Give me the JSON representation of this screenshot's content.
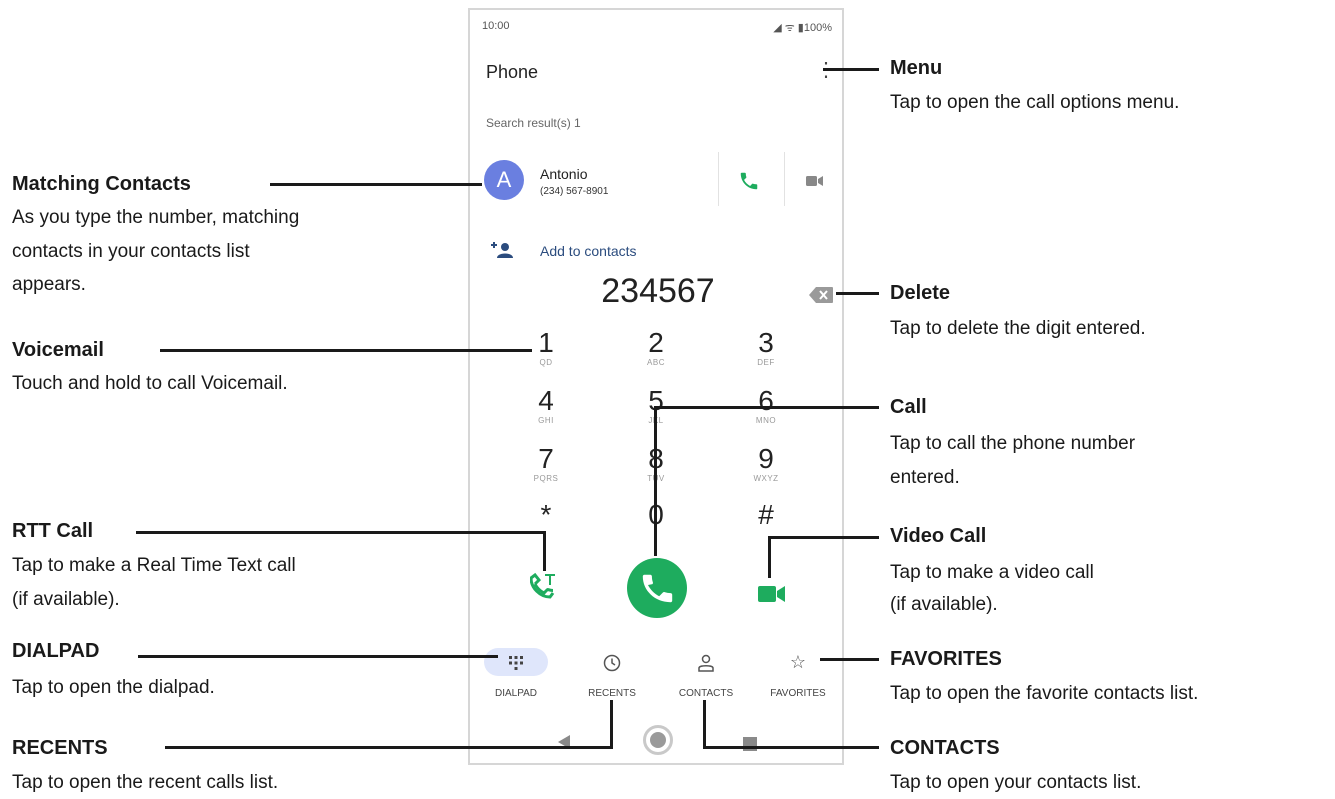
{
  "status_bar": {
    "time": "10:00",
    "indicators": "◢ ᯤ ▮100%"
  },
  "app": {
    "title": "Phone"
  },
  "search": {
    "result_text": "Search result(s) 1"
  },
  "contact": {
    "avatar_letter": "A",
    "name": "Antonio",
    "number": "(234) 567-8901"
  },
  "add_to_contacts": {
    "label": "Add to contacts"
  },
  "dialed_number": "234567",
  "keypad": [
    {
      "digit": "1",
      "letters": "QD"
    },
    {
      "digit": "2",
      "letters": "ABC"
    },
    {
      "digit": "3",
      "letters": "DEF"
    },
    {
      "digit": "4",
      "letters": "GHI"
    },
    {
      "digit": "5",
      "letters": "JKL"
    },
    {
      "digit": "6",
      "letters": "MNO"
    },
    {
      "digit": "7",
      "letters": "PQRS"
    },
    {
      "digit": "8",
      "letters": "TUV"
    },
    {
      "digit": "9",
      "letters": "WXYZ"
    },
    {
      "digit": "*",
      "letters": ""
    },
    {
      "digit": "0",
      "letters": ""
    },
    {
      "digit": "#",
      "letters": ""
    }
  ],
  "tabs": [
    {
      "label": "DIALPAD",
      "icon": "dialpad-icon"
    },
    {
      "label": "RECENTS",
      "icon": "clock-icon"
    },
    {
      "label": "CONTACTS",
      "icon": "person-icon"
    },
    {
      "label": "FAVORITES",
      "icon": "star-icon"
    }
  ],
  "colors": {
    "call_green": "#1eac5e",
    "avatar": "#6a7fe0",
    "tab_active": "#dfe6fb",
    "link_blue": "#2b4c7e"
  },
  "callouts": {
    "menu": {
      "title": "Menu",
      "desc": "Tap to open the call options menu."
    },
    "matching": {
      "title": "Matching Contacts",
      "desc1": "As you type the number, matching",
      "desc2": "contacts in your contacts list",
      "desc3": "appears."
    },
    "delete": {
      "title": "Delete",
      "desc": "Tap to delete the digit entered."
    },
    "voicemail": {
      "title": "Voicemail",
      "desc": "Touch and hold to call Voicemail."
    },
    "call": {
      "title": "Call",
      "desc1": "Tap to call the phone number",
      "desc2": "entered."
    },
    "rtt": {
      "title": "RTT Call",
      "desc1": "Tap to make a Real Time Text call",
      "desc2": "(if available)."
    },
    "video": {
      "title": "Video Call",
      "desc1": "Tap to make a video call",
      "desc2": "(if available)."
    },
    "dialpad": {
      "title": "DIALPAD",
      "desc": "Tap to open the dialpad."
    },
    "favorites": {
      "title": "FAVORITES",
      "desc": "Tap to open the favorite contacts list."
    },
    "recents": {
      "title": "RECENTS",
      "desc": "Tap to open the recent calls list."
    },
    "contacts": {
      "title": "CONTACTS",
      "desc": "Tap to open your contacts list."
    }
  }
}
